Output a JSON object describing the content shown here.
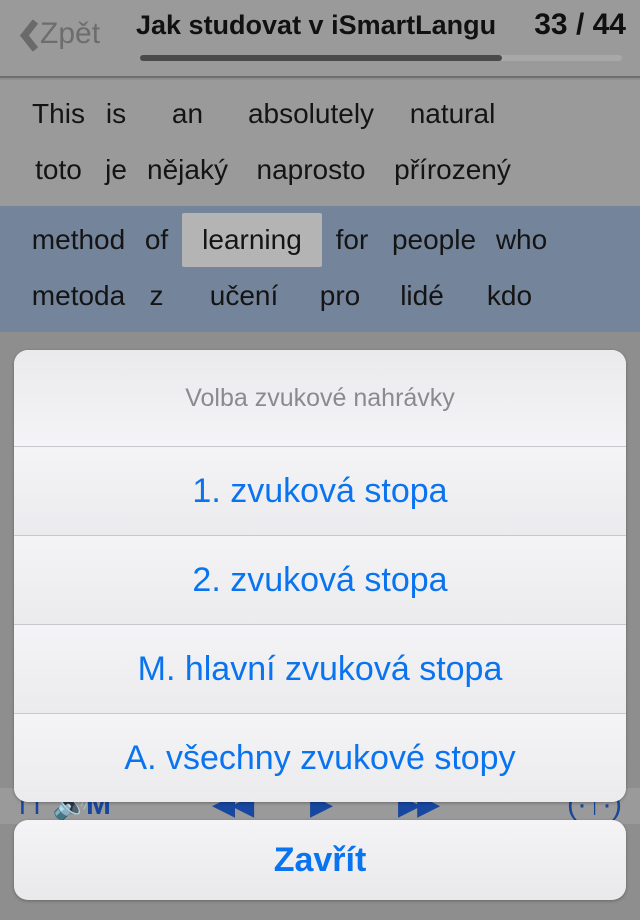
{
  "header": {
    "back_label": "Zpět",
    "back_icon": "chevron-left-icon",
    "title": "Jak studovat v iSmartLangu...",
    "page_counter": "33 / 44",
    "progress_percent": 75
  },
  "reader": {
    "blocks": [
      {
        "state": "plain",
        "source_words": [
          "This",
          "is",
          "an",
          "absolutely",
          "natural"
        ],
        "target_words": [
          "toto",
          "je",
          "nějaký",
          "naprosto",
          "přírozený"
        ],
        "highlight_index": -1
      },
      {
        "state": "active",
        "source_words": [
          "method",
          "of",
          "learning",
          "for",
          "people",
          "who"
        ],
        "target_words": [
          "metoda",
          "z",
          "učení",
          "pro",
          "lidé",
          "kdo"
        ],
        "highlight_index": 2
      }
    ]
  },
  "toolbar": {
    "loop_icon": "⊓",
    "sound_icon": "🔊",
    "mode_icon": "M",
    "rewind_icon": "◀◀",
    "play_icon": "▶",
    "forward_icon": "▶▶",
    "speed_icon": "(·↑·)"
  },
  "action_sheet": {
    "title": "Volba zvukové nahrávky",
    "options": [
      {
        "label": "1. zvuková stopa"
      },
      {
        "label": "2. zvuková stopa"
      },
      {
        "label": "M. hlavní zvuková stopa"
      },
      {
        "label": "A. všechny zvukové stopy"
      }
    ],
    "cancel_label": "Zavřít"
  },
  "colors": {
    "accent_blue": "#0a74f0",
    "toolbar_blue": "#17479e",
    "background_gray": "#9a9a9a",
    "active_block": "#74849a",
    "highlight_word": "#b4b4b4"
  }
}
